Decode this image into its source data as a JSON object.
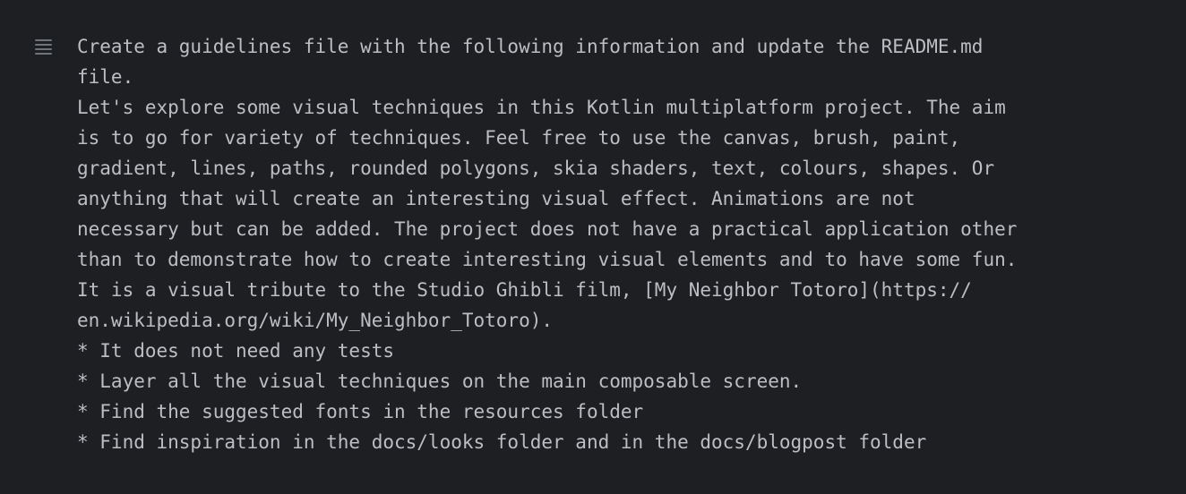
{
  "prompt": {
    "icon": "drag-handle-icon",
    "lines": [
      "Create a guidelines file with the following information and update the README.md",
      "file.",
      "Let's explore some visual techniques in this Kotlin multiplatform project. The aim",
      "is to go for variety of techniques. Feel free to use the canvas, brush, paint,",
      "gradient, lines, paths, rounded polygons, skia shaders, text, colours, shapes. Or",
      "anything that will create an interesting visual effect. Animations are not",
      "necessary but can be added. The project does not have a practical application other",
      "than to demonstrate how to create interesting visual elements and to have some fun.",
      "It is a visual tribute to the Studio Ghibli film, [My Neighbor Totoro](https://",
      "en.wikipedia.org/wiki/My_Neighbor_Totoro).",
      "* It does not need any tests",
      "* Layer all the visual techniques on the main composable screen.",
      "* Find the suggested fonts in the resources folder",
      "* Find inspiration in the docs/looks folder and in the docs/blogpost folder"
    ]
  }
}
